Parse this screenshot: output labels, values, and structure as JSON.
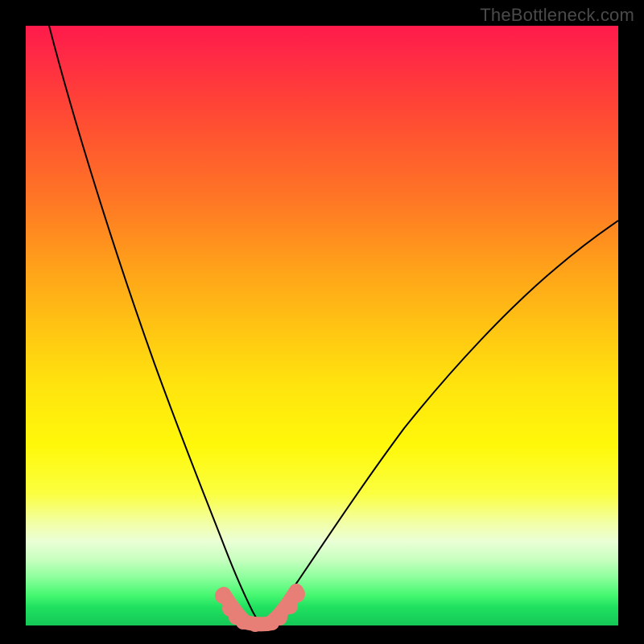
{
  "watermark": "TheBottleneck.com",
  "chart_data": {
    "type": "line",
    "title": "",
    "xlabel": "",
    "ylabel": "",
    "xlim": [
      0,
      100
    ],
    "ylim": [
      0,
      100
    ],
    "grid": false,
    "legend": false,
    "series": [
      {
        "name": "left-curve",
        "x": [
          4,
          8,
          12,
          16,
          20,
          24,
          27,
          30,
          33,
          35,
          37,
          38,
          39
        ],
        "y": [
          100,
          80,
          62,
          47,
          34,
          23,
          15,
          9,
          5,
          2.5,
          1,
          0.3,
          0
        ]
      },
      {
        "name": "right-curve",
        "x": [
          39,
          42,
          46,
          50,
          55,
          60,
          66,
          72,
          80,
          88,
          96,
          100
        ],
        "y": [
          0,
          1.5,
          5,
          10,
          17,
          25,
          33,
          41,
          50,
          58,
          65,
          68
        ]
      }
    ],
    "markers": {
      "name": "bottom-markers",
      "color": "#e77f77",
      "points": [
        {
          "x": 33.3,
          "y": 4.8
        },
        {
          "x": 34.5,
          "y": 2.6
        },
        {
          "x": 35.4,
          "y": 1.1
        },
        {
          "x": 36.6,
          "y": 0.35
        },
        {
          "x": 38.7,
          "y": 0.05
        },
        {
          "x": 40.8,
          "y": 0.15
        },
        {
          "x": 42.8,
          "y": 1.3
        },
        {
          "x": 44.5,
          "y": 3.2
        },
        {
          "x": 45.7,
          "y": 5.2
        }
      ]
    },
    "background_gradient": {
      "top": "#ff1a4b",
      "mid": "#fff80a",
      "bottom": "#15c857"
    }
  }
}
